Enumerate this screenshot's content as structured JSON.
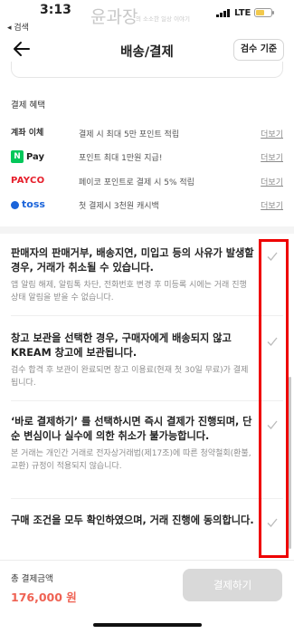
{
  "status_bar": {
    "time": "3:13",
    "back_app": "◂ 검색",
    "network": "LTE",
    "battery_level": 0.55,
    "watermark_main": "윤과장",
    "watermark_sub": "의 소소한 일상 이야기"
  },
  "header": {
    "title": "배송/결제",
    "inspect_button": "검수 기준"
  },
  "benefits": {
    "section_title": "결제 혜택",
    "items": [
      {
        "logo": "계좌 이체",
        "description": "결제 시 최대 5만 포인트 적립",
        "more": "더보기"
      },
      {
        "logo": "Pay",
        "description": "포인트 최대 1만원 지급!",
        "more": "더보기"
      },
      {
        "logo": "PAYCO",
        "description": "페이코 포인트로 결제 시 5% 적립",
        "more": "더보기"
      },
      {
        "logo": "toss",
        "description": "첫 결제시 3천원 캐시백",
        "more": "더보기"
      }
    ]
  },
  "agreements": [
    {
      "main": "판매자의 판매거부, 배송지연, 미입고 등의 사유가 발생할 경우, 거래가 취소될 수 있습니다.",
      "sub": "앱 알림 해제, 알림톡 차단, 전화번호 변경 후 미등록 시에는 거래 진행 상태 알림을 받을 수 없습니다."
    },
    {
      "main": "창고 보관을 선택한 경우, 구매자에게 배송되지 않고 KREAM 창고에 보관됩니다.",
      "sub": "검수 합격 후 보관이 완료되면 창고 이용료(현재 첫 30일 무료)가 결제됩니다."
    },
    {
      "main": "‘바로 결제하기’ 를 선택하시면 즉시 결제가 진행되며, 단순 변심이나 실수에 의한 취소가 불가능합니다.",
      "sub": "본 거래는 개인간 거래로 전자상거래법(제17조)에 따른 청약철회(환불, 교환) 규정이 적용되지 않습니다."
    },
    {
      "main": "구매 조건을 모두 확인하였으며, 거래 진행에 동의합니다.",
      "sub": ""
    }
  ],
  "footer": {
    "total_label": "총 결제금액",
    "total_value": "176,000 원",
    "pay_button": "결제하기"
  },
  "colors": {
    "accent_price": "#ef6253",
    "highlight_box": "#e00000",
    "disabled_button": "#d9d9d9",
    "npay_green": "#03c75a",
    "payco_red": "#e61e2a",
    "toss_blue": "#1b64da"
  }
}
